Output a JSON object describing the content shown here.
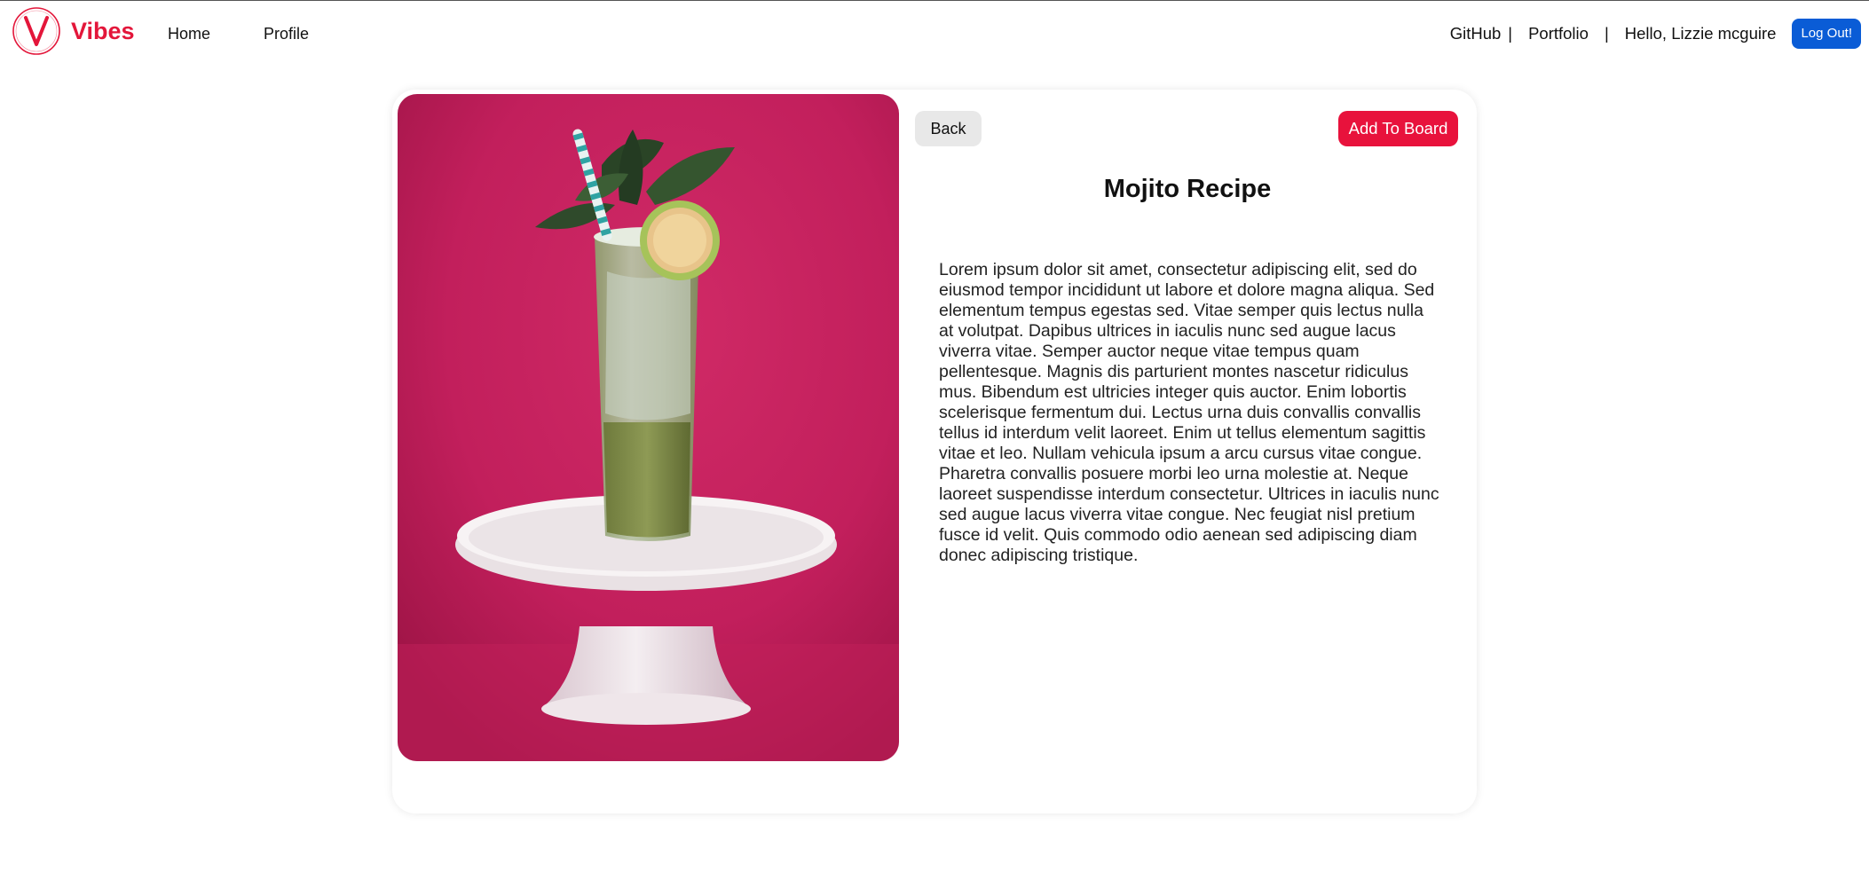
{
  "app": {
    "name": "Vibes",
    "logo_letter": "V",
    "brand_color": "#e3163a"
  },
  "nav": {
    "home": "Home",
    "profile": "Profile",
    "github": "GitHub",
    "separator": "|",
    "portfolio": "Portfolio",
    "greeting": "Hello, Lizzie mcguire",
    "logout": "Log Out!"
  },
  "pin": {
    "image_icon": "mojito-photo",
    "back_label": "Back",
    "add_label": "Add To Board",
    "title": "Mojito Recipe",
    "description": "Lorem ipsum dolor sit amet, consectetur adipiscing elit, sed do eiusmod tempor incididunt ut labore et dolore magna aliqua. Sed elementum tempus egestas sed. Vitae semper quis lectus nulla at volutpat. Dapibus ultrices in iaculis nunc sed augue lacus viverra vitae. Semper auctor neque vitae tempus quam pellentesque. Magnis dis parturient montes nascetur ridiculus mus. Bibendum est ultricies integer quis auctor. Enim lobortis scelerisque fermentum dui. Lectus urna duis convallis convallis tellus id interdum velit laoreet. Enim ut tellus elementum sagittis vitae et leo. Nullam vehicula ipsum a arcu cursus vitae congue. Pharetra convallis posuere morbi leo urna molestie at. Neque laoreet suspendisse interdum consectetur. Ultrices in iaculis nunc sed augue lacus viverra vitae congue. Nec feugiat nisl pretium fusce id velit. Quis commodo odio aenean sed adipiscing diam donec adipiscing tristique."
  },
  "colors": {
    "add_button": "#e8123c",
    "logout_button": "#0a5cd6",
    "photo_background": "#c8205e"
  }
}
